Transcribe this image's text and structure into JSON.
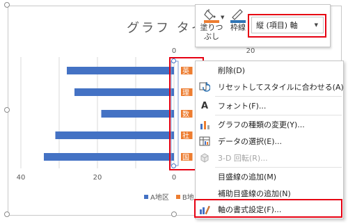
{
  "chart": {
    "title": "グラフ タイ",
    "legend": [
      {
        "label": "A地区",
        "color": "#4472c4"
      },
      {
        "label": "B地",
        "color": "#ed7d31"
      }
    ]
  },
  "chart_data": {
    "type": "bar",
    "orientation": "horizontal",
    "categories": [
      "国語",
      "社会",
      "数学",
      "理科",
      "英語"
    ],
    "category_labels_visible": [
      "国",
      "社",
      "数",
      "理",
      "英"
    ],
    "series": [
      {
        "name": "A地区",
        "values": [
          34,
          31,
          19,
          26,
          28
        ]
      },
      {
        "name": "B地",
        "values": [
          3,
          3,
          3,
          3,
          3
        ]
      }
    ],
    "x_ticks_bottom": [
      "40",
      "20",
      "0"
    ],
    "x_ticks_top": [
      "0",
      "20"
    ],
    "xlim": [
      0,
      40
    ],
    "reversed": true,
    "grid": "vertical"
  },
  "mini_toolbar": {
    "fill_label_1": "塗りつ",
    "fill_label_2": "ぶし",
    "outline_label": "枠線",
    "selected_element": "縦 (項目) 軸",
    "fill_color": "#ed7d31",
    "outline_color": "#2e74b5"
  },
  "context_menu": {
    "items": [
      {
        "label": "削除(D)",
        "icon": "none",
        "enabled": true
      },
      {
        "label": "リセットしてスタイルに合わせる(A)",
        "icon": "reset-style-icon",
        "enabled": true
      },
      {
        "label": "フォント(F)...",
        "icon": "font-icon",
        "enabled": true
      },
      {
        "label": "グラフの種類の変更(Y)...",
        "icon": "chart-type-icon",
        "enabled": true
      },
      {
        "label": "データの選択(E)...",
        "icon": "select-data-icon",
        "enabled": true
      },
      {
        "label": "3-D 回転(R)...",
        "icon": "rotate-3d-icon",
        "enabled": false
      },
      {
        "label": "目盛線の追加(M)",
        "icon": "none",
        "enabled": true
      },
      {
        "label": "補助目盛線の追加(N)",
        "icon": "none",
        "enabled": true
      },
      {
        "label": "軸の書式設定(F)...",
        "icon": "format-axis-icon",
        "enabled": true
      }
    ]
  },
  "highlight_color": "#e60012"
}
